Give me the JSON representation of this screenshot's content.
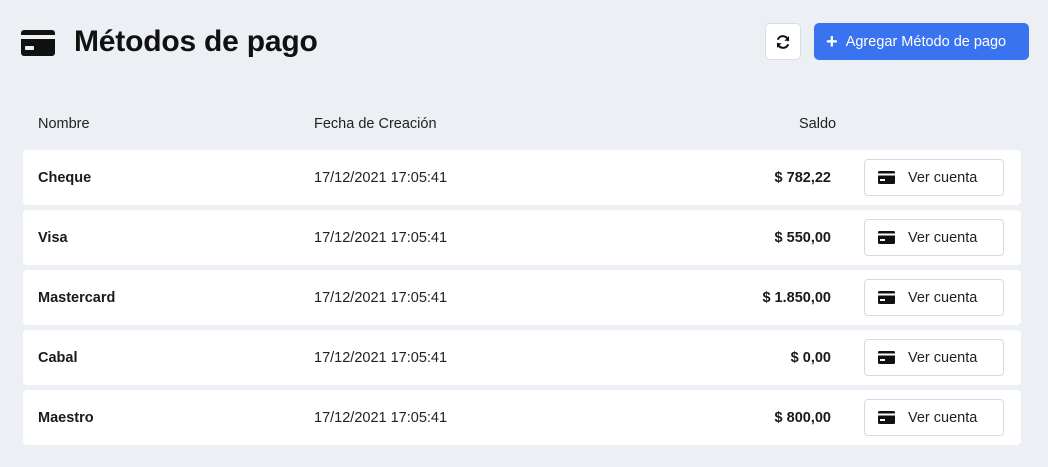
{
  "header": {
    "icon": "credit-card-icon",
    "title": "Métodos de pago",
    "refresh_icon": "refresh-icon",
    "add_label": "Agregar Método de pago",
    "add_icon": "plus-icon",
    "accent_color": "#3a73f0"
  },
  "table": {
    "headers": {
      "name": "Nombre",
      "date": "Fecha de Creación",
      "balance": "Saldo"
    },
    "rows": [
      {
        "name": "Cheque",
        "date": "17/12/2021 17:05:41",
        "balance": "$ 782,22",
        "action": "Ver cuenta"
      },
      {
        "name": "Visa",
        "date": "17/12/2021 17:05:41",
        "balance": "$ 550,00",
        "action": "Ver cuenta"
      },
      {
        "name": "Mastercard",
        "date": "17/12/2021 17:05:41",
        "balance": "$ 1.850,00",
        "action": "Ver cuenta"
      },
      {
        "name": "Cabal",
        "date": "17/12/2021 17:05:41",
        "balance": "$ 0,00",
        "action": "Ver cuenta"
      },
      {
        "name": "Maestro",
        "date": "17/12/2021 17:05:41",
        "balance": "$ 800,00",
        "action": "Ver cuenta"
      }
    ]
  }
}
